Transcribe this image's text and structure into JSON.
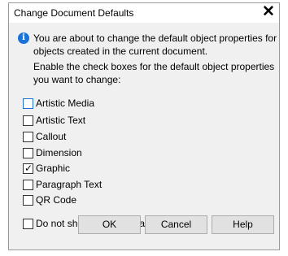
{
  "dialog": {
    "title": "Change Document Defaults",
    "close_glyph": "✕",
    "info_text": "You are about to change the default object properties for objects created in the current document.",
    "enable_text": "Enable the check boxes for the default object properties you want to change:",
    "options": [
      {
        "label": "Artistic Media",
        "checked": false
      },
      {
        "label": "Artistic Text",
        "checked": false
      },
      {
        "label": "Callout",
        "checked": false
      },
      {
        "label": "Dimension",
        "checked": false
      },
      {
        "label": "Graphic",
        "checked": true
      },
      {
        "label": "Paragraph Text",
        "checked": false
      },
      {
        "label": "QR Code",
        "checked": false
      }
    ],
    "dont_show": {
      "label": "Do not show this dialog again",
      "checked": false
    },
    "buttons": {
      "ok": "OK",
      "cancel": "Cancel",
      "help": "Help"
    },
    "check_glyph": "✓",
    "info_icon_glyph": "i"
  }
}
